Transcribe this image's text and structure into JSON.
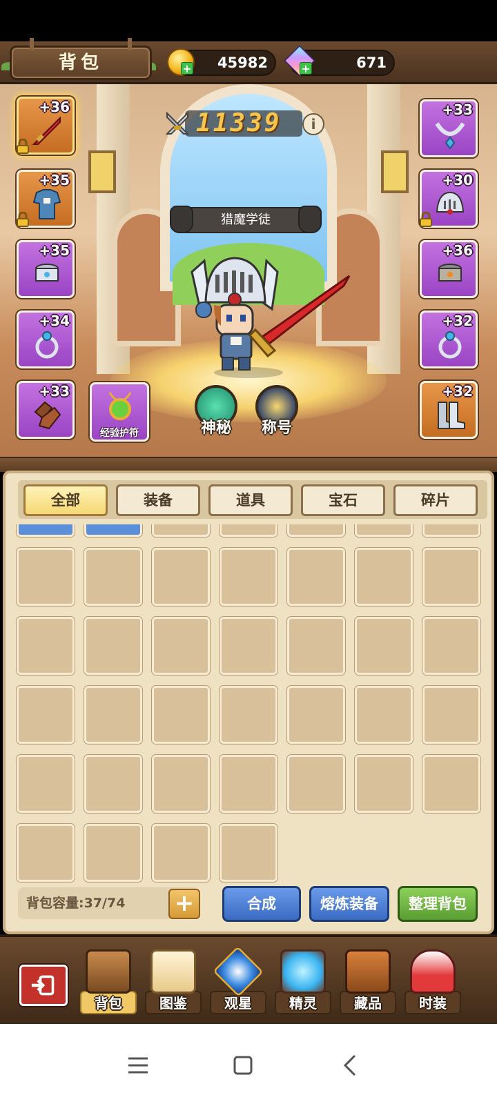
{
  "header": {
    "title": "背包",
    "gold": "45982",
    "gems": "671"
  },
  "stage": {
    "combat_power": "11339",
    "player_title": "猎魔学徒"
  },
  "equipment": {
    "left": [
      {
        "level": "+36",
        "item": "sword",
        "locked": true,
        "selected": true,
        "rarity": "orange"
      },
      {
        "level": "+35",
        "item": "armor",
        "locked": true,
        "selected": false,
        "rarity": "orange"
      },
      {
        "level": "+35",
        "item": "bracer",
        "locked": false,
        "selected": false,
        "rarity": "purple"
      },
      {
        "level": "+34",
        "item": "ring",
        "locked": false,
        "selected": false,
        "rarity": "purple"
      },
      {
        "level": "+33",
        "item": "gloves",
        "locked": false,
        "selected": false,
        "rarity": "purple"
      }
    ],
    "right": [
      {
        "level": "+33",
        "item": "necklace",
        "locked": false,
        "rarity": "purple"
      },
      {
        "level": "+30",
        "item": "helmet",
        "locked": true,
        "rarity": "purple"
      },
      {
        "level": "+36",
        "item": "bracer",
        "locked": false,
        "rarity": "purple"
      },
      {
        "level": "+32",
        "item": "ring",
        "locked": false,
        "rarity": "purple"
      },
      {
        "level": "+32",
        "item": "boots",
        "locked": false,
        "rarity": "orange"
      }
    ],
    "amulet_label": "经验护符",
    "mystery_label": "神秘",
    "title_label": "称号"
  },
  "inventory": {
    "tabs": [
      "全部",
      "装备",
      "道具",
      "宝石",
      "碎片"
    ],
    "active_tab": 0,
    "capacity_text": "背包容量:37/74",
    "buttons": {
      "synthesize": "合成",
      "smelt": "熔炼装备",
      "sort": "整理背包"
    }
  },
  "nav": {
    "items": [
      "背包",
      "图鉴",
      "观星",
      "精灵",
      "藏品",
      "时装"
    ],
    "active": 0
  },
  "colors": {
    "slot_purple": "#b05ad6",
    "slot_orange": "#d88236",
    "panel_bg": "#efe2c2",
    "power_gold": "#f6c54e"
  }
}
